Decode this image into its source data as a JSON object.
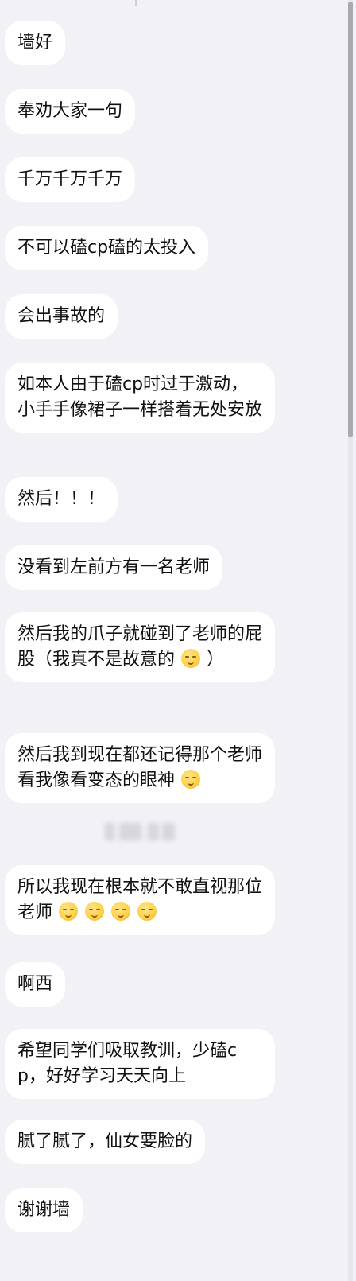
{
  "messages": [
    "墙好",
    "奉劝大家一句",
    "千万千万千万",
    "不可以磕cp磕的太投入",
    "会出事故的",
    "如本人由于磕cp时过于激动，小手手像裙子一样搭着无处安放",
    "然后！！！",
    "没看到左前方有一名老师",
    {
      "text": "然后我的爪子就碰到了老师的屁股（我真不是故意的",
      "emoji": "relieved-face-icon",
      "tail": "）"
    },
    {
      "text": "然后我到现在都还记得那个老师看我像看变态的眼神",
      "emoji": "slight-smile-face-icon"
    },
    {
      "text": "所以我现在根本就不敢直视那位老师",
      "emoji_repeat": 4,
      "emoji": "slight-smile-face-icon"
    },
    "啊西",
    "希望同学们吸取教训，少磕cp，好好学习天天向上",
    "腻了腻了，仙女要脸的",
    "谢谢墙"
  ],
  "colors": {
    "background": "#f1f1f6",
    "bubble": "#ffffff",
    "text": "#111111",
    "scrollbar_thumb": "#a9a9b0"
  }
}
